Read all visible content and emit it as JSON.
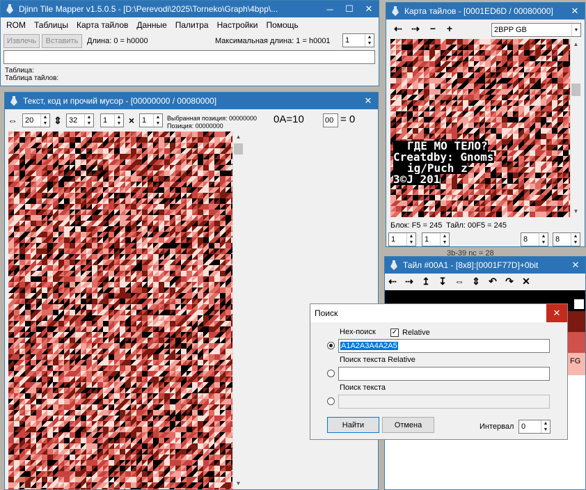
{
  "main_window": {
    "title": "Djinn Tile Mapper v1.5.0.5 - [D:\\Perevodi\\2025\\Torneko\\Graph\\4bpp\\...",
    "menu": [
      "ROM",
      "Таблицы",
      "Карта тайлов",
      "Данные",
      "Палитра",
      "Настройки",
      "Помощь"
    ],
    "extract_label": "Извлечь",
    "insert_label": "Вставить",
    "length_text": "Длина: 0 = h0000",
    "max_length_text": "Максимальная длина: 1 = h0001",
    "spin_value": "1",
    "table_label": "Таблица:",
    "tile_table_label": "Таблица тайлов:"
  },
  "text_window": {
    "title": "Текст, код и прочий мусор - [00000000 / 00080000]",
    "width_value": "20",
    "height_value": "32",
    "spin_a": "1",
    "spin_b": "1",
    "selected_pos": "Выбранная позиция: 00000000",
    "position": "Позиция: 00000000",
    "byte_text": "0A=10",
    "char_input": "00",
    "char_result": "= 0"
  },
  "map_window": {
    "title": "Карта тайлов - [0001ED6D / 00080000]",
    "codec": "2BPP GB",
    "block_text": "Блок: F5 = 245",
    "tile_text": "Тайл: 00F5 = 245",
    "spin_values": [
      "1",
      "1",
      "8",
      "8"
    ],
    "overlay_lines": [
      "ГДЕ МО ТЕЛО?",
      "Creatdby: Gnoms",
      "ig/Puch  z",
      "3©J 201"
    ]
  },
  "tile_window": {
    "title": "Тайл #00A1 - [8x8]:[0001F77D]+0bit",
    "behind_text": "3b-39  nc = 28",
    "side_text": "FG"
  },
  "search_dialog": {
    "title": "Поиск",
    "hex_label": "Hex-поиск",
    "relative_label": "Relative",
    "relative_checked": true,
    "hex_value": "A1A2A3A4A2A5",
    "text_relative_label": "Поиск текста Relative",
    "text_label": "Поиск текста",
    "find_label": "Найти",
    "cancel_label": "Отмена",
    "interval_label": "Интервал",
    "interval_value": "0"
  },
  "colors": {
    "title_active": "#2b73b6",
    "tile_dark": "#7a1a10",
    "tile_red": "#c8433e",
    "tile_pink": "#f4a39a",
    "tile_light": "#fde0d8",
    "selection": "#0078d7"
  }
}
